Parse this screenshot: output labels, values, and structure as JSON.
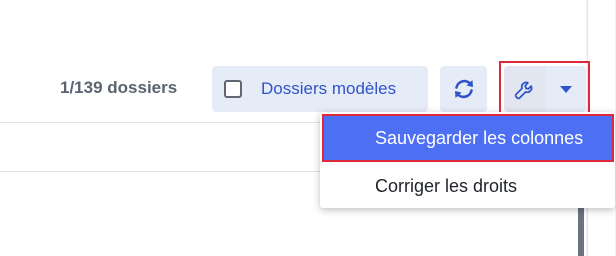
{
  "toolbar": {
    "count_text": "1/139 dossiers",
    "model_checkbox_label": "Dossiers modèles",
    "refresh_icon": "refresh-icon",
    "settings_icon": "wrench-icon",
    "dropdown_icon": "caret-down-icon"
  },
  "menu": {
    "items": [
      {
        "label": "Sauvegarder les colonnes",
        "highlighted": true
      },
      {
        "label": "Corriger les droits",
        "highlighted": false
      }
    ]
  },
  "colors": {
    "accent": "#2f54c9",
    "button_bg": "#e6ebf8",
    "menu_highlight": "#4c6ff4",
    "annotation_red": "#e0283c"
  }
}
